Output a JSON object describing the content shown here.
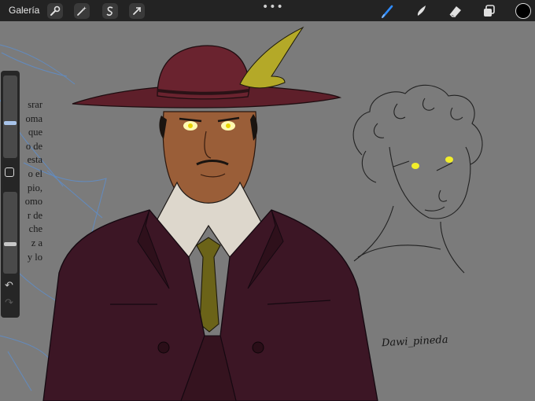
{
  "toolbar": {
    "gallery_label": "Galería",
    "more_label": "•••",
    "left_icons": [
      "wrench-icon",
      "magic-wand-icon",
      "selection-s-icon",
      "transform-arrow-icon"
    ],
    "right_icons": [
      "brush-icon",
      "smudge-icon",
      "eraser-icon",
      "layers-icon"
    ],
    "active_tool": "brush-icon",
    "brush_accent": "#2e8bff",
    "current_color": "#000000"
  },
  "canvas": {
    "background_text": [
      "srar",
      "oma",
      "que",
      "o de",
      "esta",
      "o el",
      "pio,",
      "omo",
      "r de",
      "che",
      "z a",
      "y lo"
    ],
    "signature": "Dawi_pineda"
  },
  "sidebar": {
    "brush_size_level": 0.42,
    "opacity_level": 0.35,
    "undo_glyph": "↶",
    "redo_glyph": "↷"
  }
}
